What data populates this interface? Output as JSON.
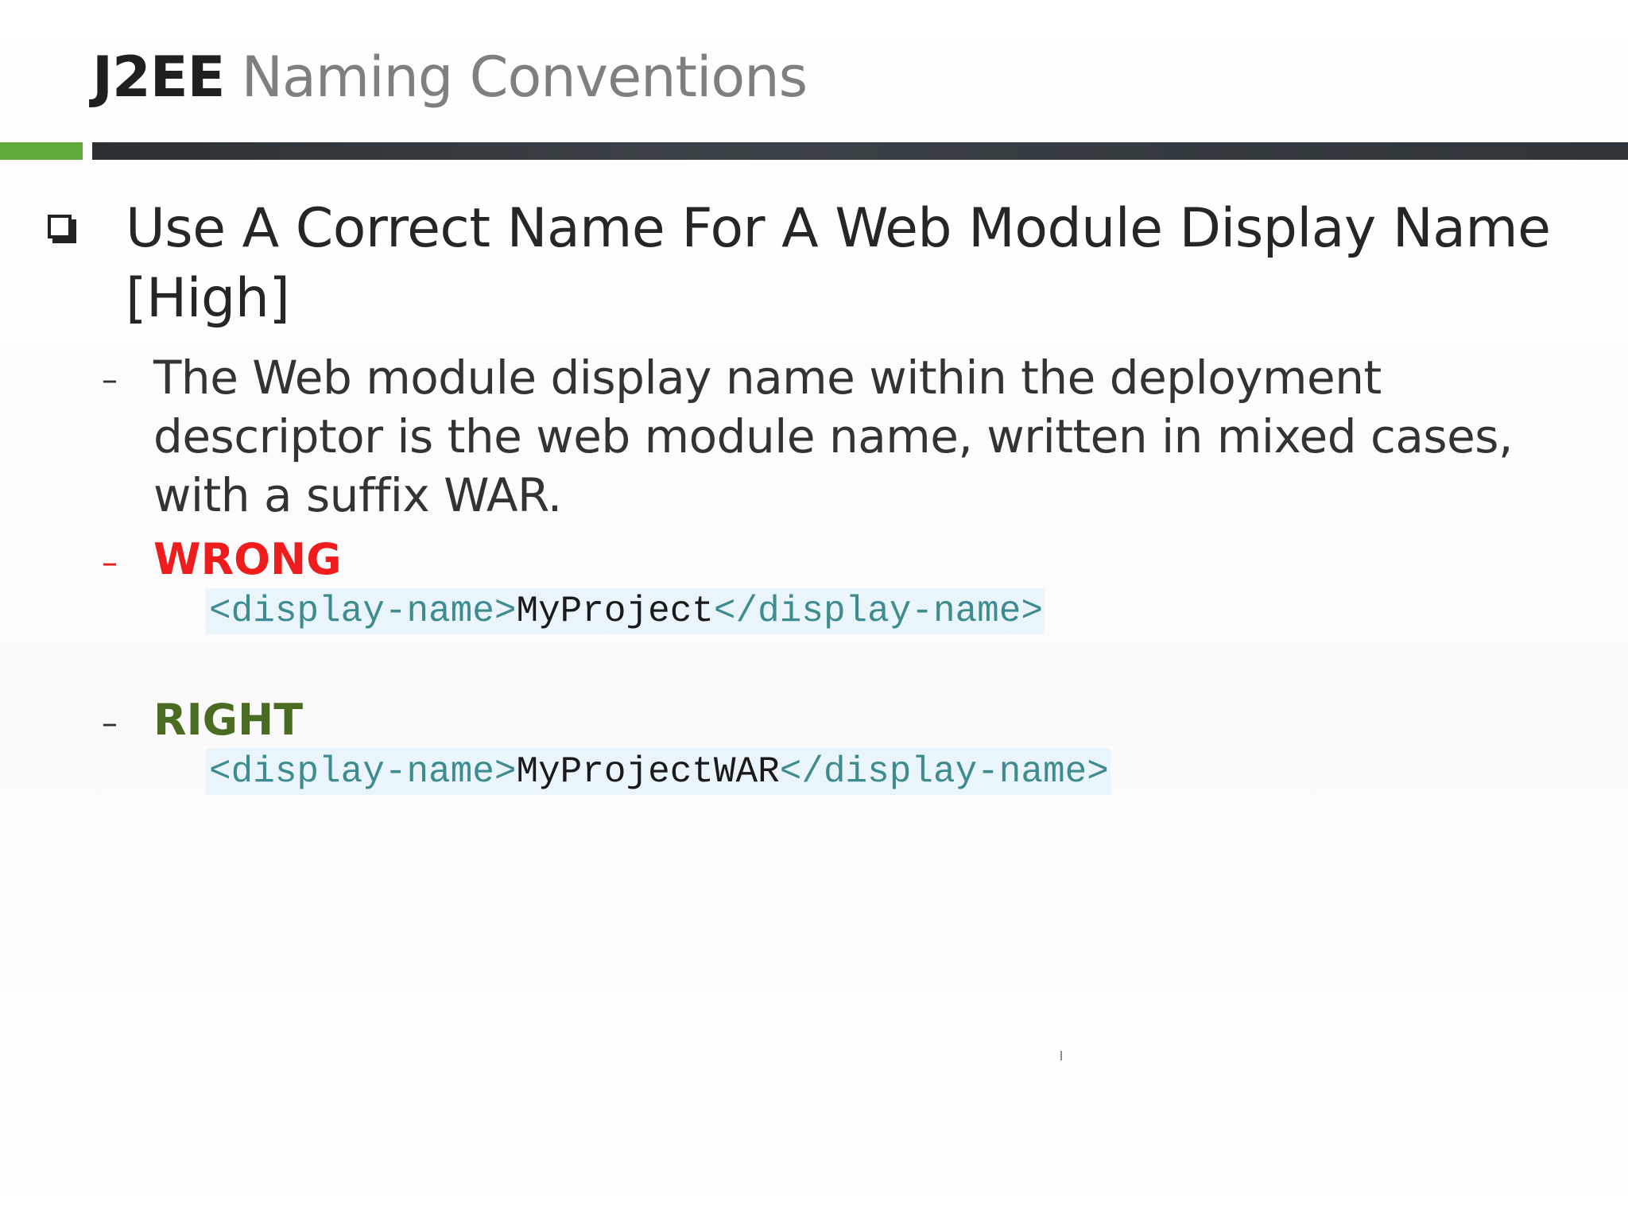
{
  "slide": {
    "title_bold": "J2EE",
    "title_light": "Naming Conventions",
    "main_point": "Use A Correct Name For A Web Module Display Name [High]",
    "description": "The Web module display name within the deployment descriptor is the web module name, written in mixed cases, with a suffix WAR.",
    "wrong_label": "WRONG",
    "wrong_code": {
      "open_tag": "<display-name>",
      "value": "MyProject",
      "close_tag": "</display-name>"
    },
    "right_label": "RIGHT",
    "right_code": {
      "open_tag": "<display-name>",
      "value": "MyProjectWAR",
      "close_tag": "</display-name>"
    },
    "dash": "–",
    "colors": {
      "accent_green": "#5fa93a",
      "header_bar": "#2c3033",
      "wrong": "#ee1c1c",
      "right": "#4a6b22",
      "code_tag": "#3e8c8f",
      "code_bg": "#eaf4fb"
    },
    "icons": {
      "bullet": "checkbox-square-icon"
    }
  }
}
